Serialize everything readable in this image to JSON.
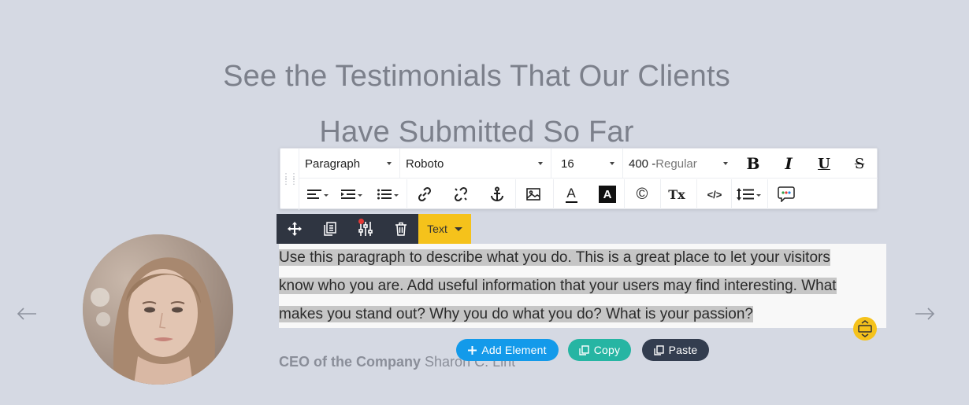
{
  "heading": {
    "line1": "See the Testimonials That Our Clients",
    "line2": "Have Submitted So Far"
  },
  "toolbar": {
    "block_type": "Paragraph",
    "font_family": "Roboto",
    "font_size": "16",
    "font_weight_num": "400 -",
    "font_weight_name": "Regular",
    "bold": "B",
    "italic": "I",
    "underline": "U",
    "strike": "S",
    "text_color_glyph": "A",
    "bg_color_glyph": "A",
    "copyright_glyph": "©",
    "clear_format_glyph": "Tx",
    "code_glyph": "</>"
  },
  "element_toolbar": {
    "type_label": "Text"
  },
  "paragraph": {
    "line1": "Use this paragraph to describe what you do. This is a great place to let your visitors",
    "line2": "know who you are. Add useful information that your users may find interesting. What",
    "line3": "makes you stand out? Why you do what you do? What is your passion?"
  },
  "author": {
    "role": "CEO of the Company",
    "name": "Sharon C. Lint"
  },
  "actions": {
    "add_element": "Add Element",
    "copy": "Copy",
    "paste": "Paste"
  },
  "colors": {
    "background": "#d5d9e3",
    "accent_yellow": "#f5c21b",
    "add_blue": "#139aea",
    "copy_teal": "#26b5a3",
    "paste_dark": "#333d4f"
  }
}
